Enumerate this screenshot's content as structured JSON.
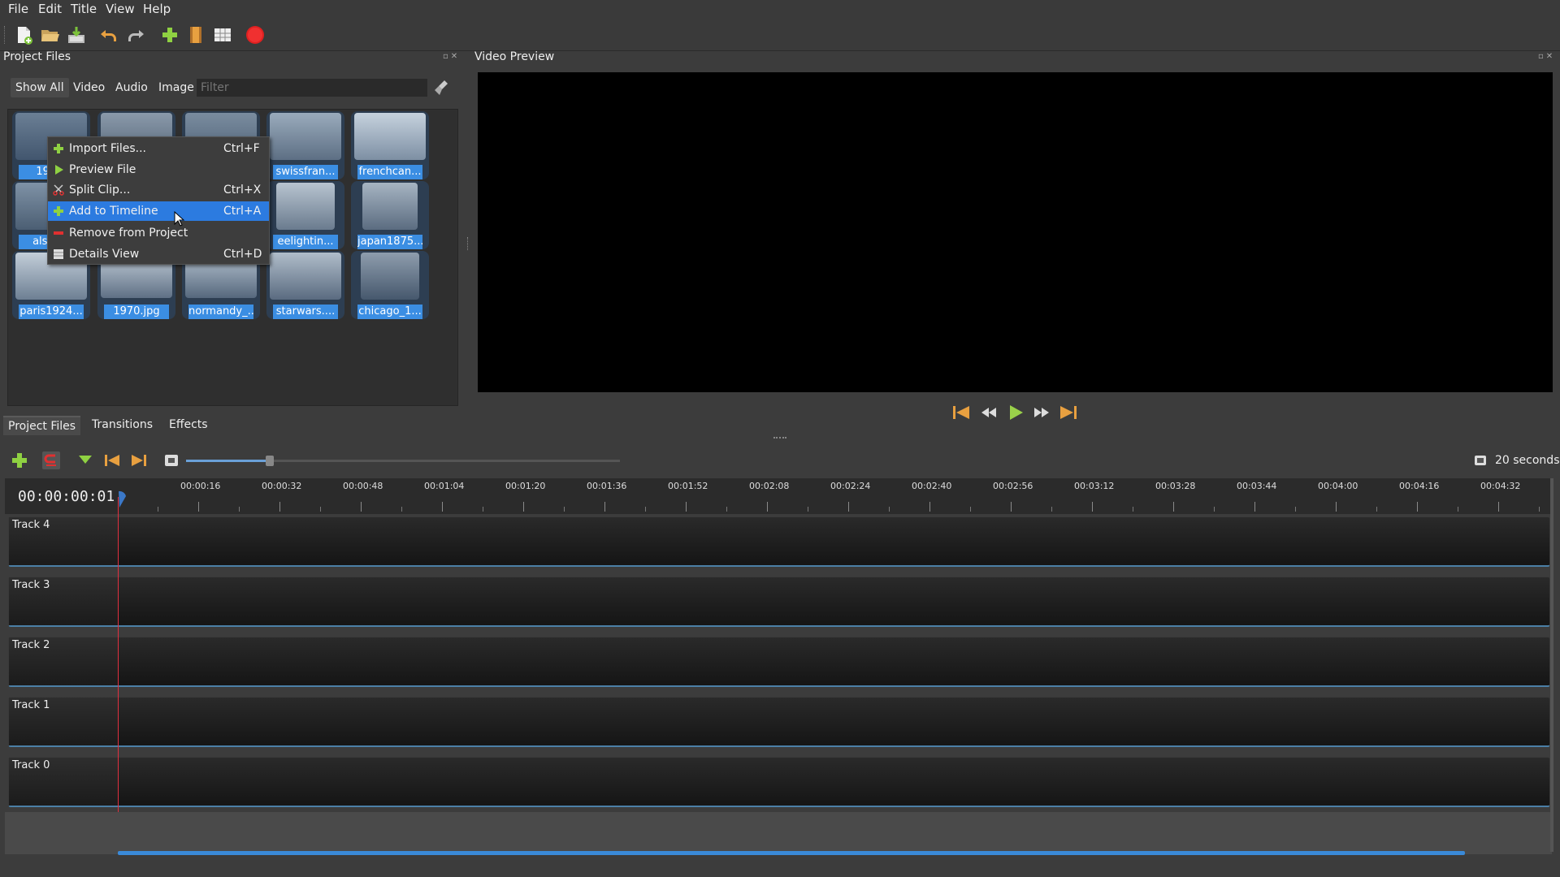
{
  "menubar": {
    "file": "File",
    "edit": "Edit",
    "title": "Title",
    "view": "View",
    "help": "Help"
  },
  "toolbar": {
    "icons": [
      "new-project-icon",
      "open-project-icon",
      "save-project-icon",
      "undo-icon",
      "redo-icon",
      "import-files-icon",
      "choose-profile-icon",
      "fullscreen-icon",
      "export-video-icon"
    ]
  },
  "panels": {
    "project_files_title": "Project Files",
    "video_preview_title": "Video Preview"
  },
  "filters": {
    "show_all": "Show All",
    "video": "Video",
    "audio": "Audio",
    "image": "Image",
    "placeholder": "Filter"
  },
  "files": [
    {
      "label": "194..."
    },
    {
      "label": ""
    },
    {
      "label": ""
    },
    {
      "label": "swissfran..."
    },
    {
      "label": "frenchcan..."
    },
    {
      "label": "alsac..."
    },
    {
      "label": ""
    },
    {
      "label": ""
    },
    {
      "label": "eelightin..."
    },
    {
      "label": "japan1875..."
    },
    {
      "label": "paris1924..."
    },
    {
      "label": "1970.jpg"
    },
    {
      "label": "normandy_..."
    },
    {
      "label": "starwars...."
    },
    {
      "label": "chicago_1..."
    }
  ],
  "context_menu": {
    "items": [
      {
        "label": "Import Files...",
        "shortcut": "Ctrl+F",
        "icon": "plus-icon"
      },
      {
        "label": "Preview File",
        "shortcut": "",
        "icon": "play-icon"
      },
      {
        "label": "Split Clip...",
        "shortcut": "Ctrl+X",
        "icon": "scissors-icon"
      },
      {
        "label": "Add to Timeline",
        "shortcut": "Ctrl+A",
        "icon": "plus-icon"
      },
      {
        "label": "Remove from Project",
        "shortcut": "",
        "icon": "minus-icon"
      },
      {
        "label": "Details View",
        "shortcut": "Ctrl+D",
        "icon": "details-icon"
      }
    ]
  },
  "bottom_tabs": {
    "project_files": "Project Files",
    "transitions": "Transitions",
    "effects": "Effects"
  },
  "timeline": {
    "zoom_label": "20 seconds",
    "timecode": "00:00:00:01",
    "ruler_labels": [
      "00:00:16",
      "00:00:32",
      "00:00:48",
      "00:01:04",
      "00:01:20",
      "00:01:36",
      "00:01:52",
      "00:02:08",
      "00:02:24",
      "00:02:40",
      "00:02:56",
      "00:03:12",
      "00:03:28",
      "00:03:44",
      "00:04:00",
      "00:04:16",
      "00:04:32"
    ],
    "tracks": [
      "Track 4",
      "Track 3",
      "Track 2",
      "Track 1",
      "Track 0"
    ]
  },
  "colors": {
    "accent": "#2c7be0",
    "playhead": "#e03040",
    "label_bg": "#3b8ee3"
  }
}
